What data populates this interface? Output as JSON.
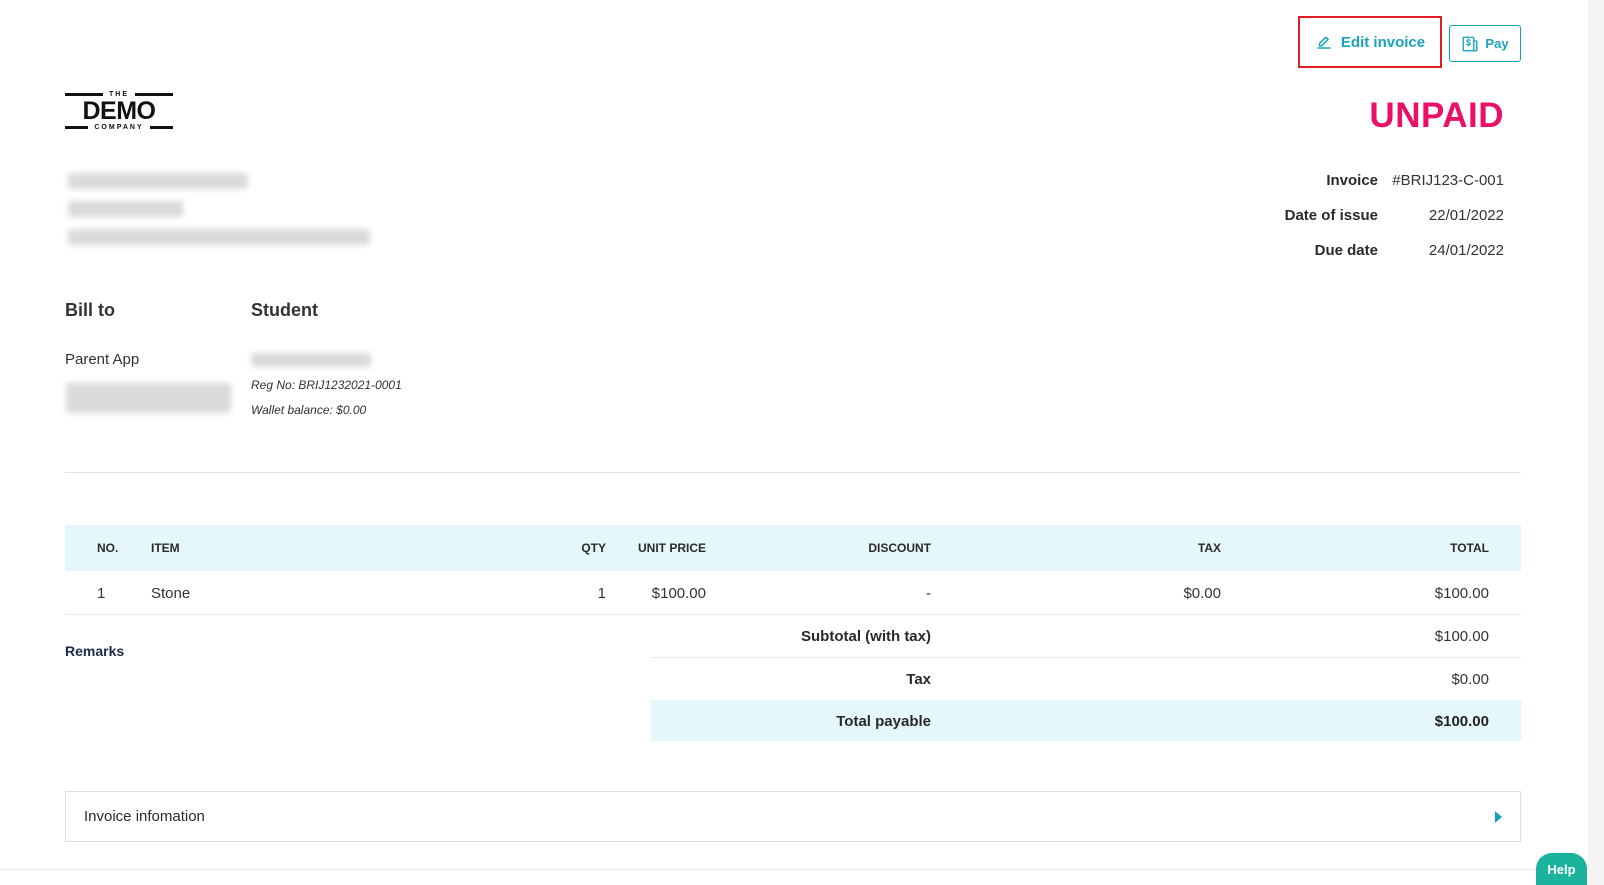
{
  "actions": {
    "edit_label": "Edit invoice",
    "pay_label": "Pay"
  },
  "logo": {
    "top": "THE",
    "main": "DEMO",
    "bottom": "COMPANY"
  },
  "status": "UNPAID",
  "meta": [
    {
      "label": "Invoice",
      "value": "#BRIJ123-C-001"
    },
    {
      "label": "Date of issue",
      "value": "22/01/2022"
    },
    {
      "label": "Due date",
      "value": "24/01/2022"
    }
  ],
  "bill_to": {
    "heading": "Bill to",
    "name": "Parent App"
  },
  "student": {
    "heading": "Student",
    "reg_no": "Reg No: BRIJ1232021-0001",
    "wallet": "Wallet balance: $0.00"
  },
  "table": {
    "headers": {
      "no": "NO.",
      "item": "ITEM",
      "qty": "QTY",
      "unit_price": "UNIT PRICE",
      "discount": "DISCOUNT",
      "tax": "TAX",
      "total": "TOTAL"
    },
    "rows": [
      {
        "no": "1",
        "item": "Stone",
        "qty": "1",
        "unit_price": "$100.00",
        "discount": "-",
        "tax": "$0.00",
        "total": "$100.00"
      }
    ]
  },
  "remarks_label": "Remarks",
  "summary": {
    "subtotal_label": "Subtotal (with tax)",
    "subtotal_value": "$100.00",
    "tax_label": "Tax",
    "tax_value": "$0.00",
    "total_label": "Total payable",
    "total_value": "$100.00"
  },
  "accordion_label": "Invoice infomation",
  "help_label": "Help",
  "colors": {
    "accent": "#16a3bb",
    "status_unpaid": "#ea1068",
    "highlight_border": "#e01e26",
    "table_header_bg": "#e4f8fb",
    "help_bg": "#1bb39b"
  }
}
